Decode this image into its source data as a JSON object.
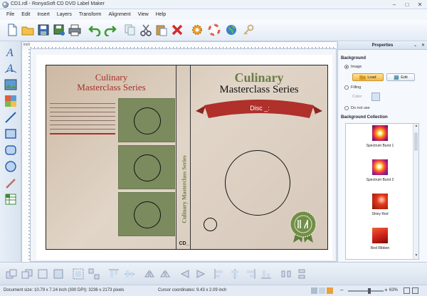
{
  "window": {
    "title": "CD1.rdl - RonyaSoft CD DVD Label Maker"
  },
  "menu": [
    "File",
    "Edit",
    "Insert",
    "Layers",
    "Transform",
    "Alignment",
    "View",
    "Help"
  ],
  "toolbar_icons": [
    "new-icon",
    "open-folder-icon",
    "save-icon",
    "save-as-icon",
    "print-icon",
    "undo-icon",
    "redo-icon",
    "copy-icon",
    "cut-icon",
    "paste-icon",
    "delete-icon",
    "settings-gear-icon",
    "help-lifebuoy-icon",
    "web-globe-icon",
    "register-key-icon"
  ],
  "left_tools": [
    "text-icon",
    "curved-text-icon",
    "image-icon",
    "image-gallery-icon",
    "line-icon",
    "rectangle-icon",
    "rounded-rectangle-icon",
    "ellipse-icon",
    "pen-icon",
    "spreadsheet-icon"
  ],
  "ruler": {
    "unit": "inch"
  },
  "cover": {
    "left_title_line1": "Culinary",
    "left_title_line2": "Masterclass Series",
    "spine_text": "Culinary Masterclass Series",
    "spine_cd": "CD_",
    "right_title_line1": "Culinary",
    "right_title_line2": "Masterclass Series",
    "disc_label": "Disc _:",
    "colors": {
      "title_red": "#a8302b",
      "title_green": "#6d7d46",
      "box_green": "#7b8b5e",
      "ribbon_red": "#b0302b"
    }
  },
  "properties": {
    "header": "Properties",
    "background_section": "Background",
    "option_image": "Image",
    "btn_load": "Load",
    "btn_edit": "Edit",
    "option_filling": "Filling",
    "color_label": "Color:",
    "option_none": "Do not use",
    "collection_section": "Background Collection",
    "collection": [
      {
        "name": "Spectrum Burst 1"
      },
      {
        "name": "Spectrum Burst 2"
      },
      {
        "name": "Shiny Red"
      },
      {
        "name": "Red Ribbon"
      }
    ]
  },
  "status": {
    "document_size": "Document size: 10.79 x 7.24 inch (300 DPI): 3236 x 2173 pixels",
    "cursor": "Cursor coordinates: 9.43 x 2.09 inch",
    "zoom": "63%"
  }
}
